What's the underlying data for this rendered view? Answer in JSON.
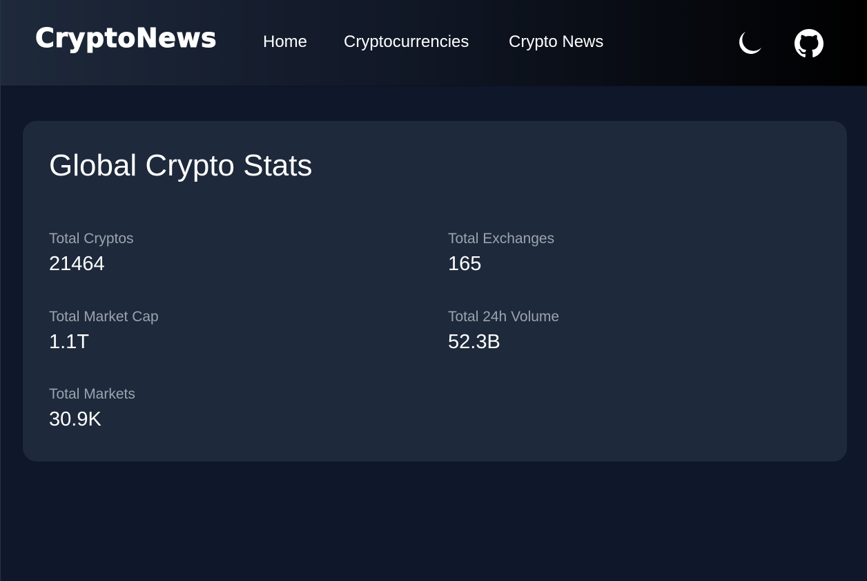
{
  "navbar": {
    "brand": "CryptoNews",
    "links": [
      {
        "label": "Home"
      },
      {
        "label": "Cryptocurrencies"
      },
      {
        "label": "Crypto News"
      }
    ],
    "icons": [
      "moon-icon",
      "github-icon"
    ]
  },
  "stats": {
    "title": "Global Crypto Stats",
    "items": [
      {
        "label": "Total Cryptos",
        "value": "21464"
      },
      {
        "label": "Total Exchanges",
        "value": "165"
      },
      {
        "label": "Total Market Cap",
        "value": "1.1T"
      },
      {
        "label": "Total 24h Volume",
        "value": "52.3B"
      },
      {
        "label": "Total Markets",
        "value": "30.9K"
      }
    ]
  },
  "colors": {
    "page_background": "#0f172a",
    "card_background": "#1e293b",
    "label_text": "#9ca3af",
    "value_text": "#ffffff"
  }
}
